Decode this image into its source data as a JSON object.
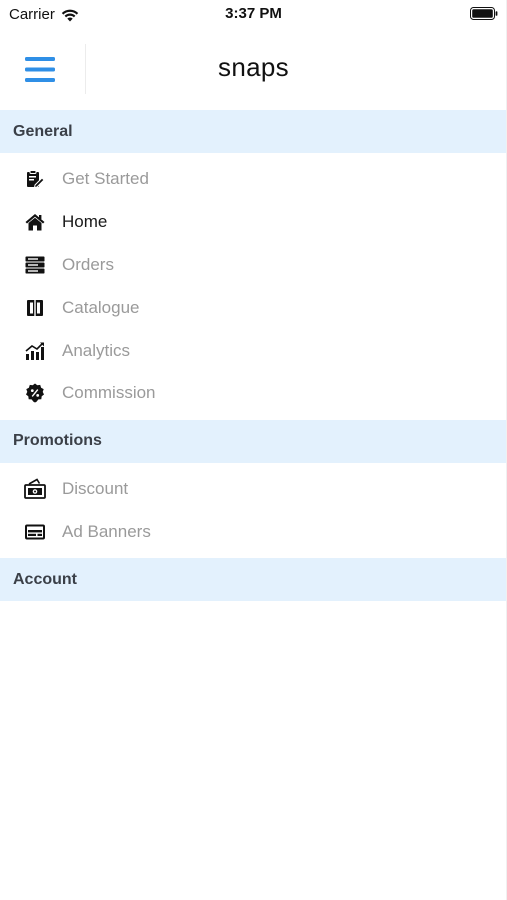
{
  "status_bar": {
    "carrier": "Carrier",
    "time": "3:37 PM"
  },
  "header": {
    "title": "snaps",
    "menu_icon": "hamburger-menu-icon",
    "accent_color": "#2f8fe6"
  },
  "sections": [
    {
      "title": "General",
      "items": [
        {
          "label": "Get Started",
          "icon": "clipboard-edit-icon",
          "active": false
        },
        {
          "label": "Home",
          "icon": "home-icon",
          "active": true
        },
        {
          "label": "Orders",
          "icon": "server-stack-icon",
          "active": false
        },
        {
          "label": "Catalogue",
          "icon": "book-catalogue-icon",
          "active": false
        },
        {
          "label": "Analytics",
          "icon": "analytics-chart-icon",
          "active": false
        },
        {
          "label": "Commission",
          "icon": "percent-badge-icon",
          "active": false
        }
      ]
    },
    {
      "title": "Promotions",
      "items": [
        {
          "label": "Discount",
          "icon": "money-discount-icon",
          "active": false
        },
        {
          "label": "Ad Banners",
          "icon": "ad-banner-icon",
          "active": false
        }
      ]
    },
    {
      "title": "Account",
      "items": []
    }
  ],
  "colors": {
    "section_background": "#e3f1fd",
    "inactive_text": "#9a9a9a",
    "active_text": "#1a1a1a"
  }
}
